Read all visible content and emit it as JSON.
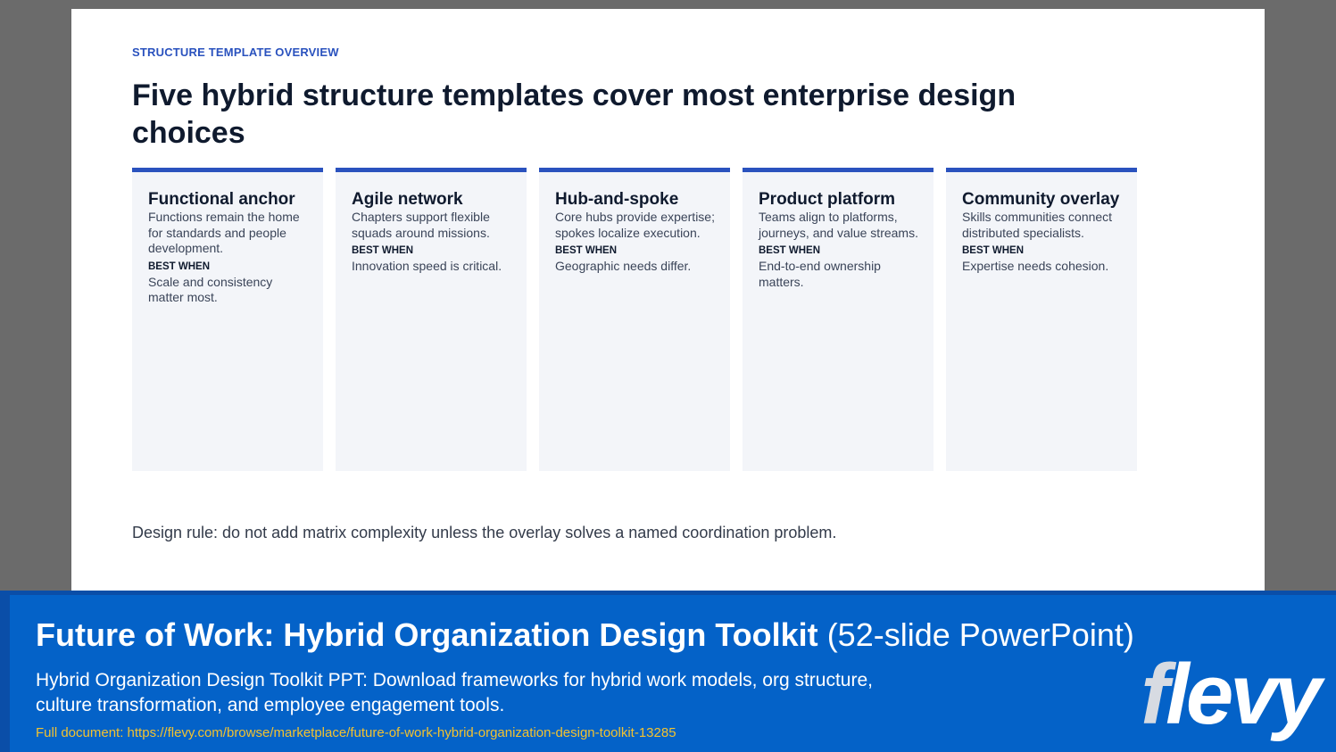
{
  "slide": {
    "eyebrow": "STRUCTURE TEMPLATE OVERVIEW",
    "title": "Five hybrid structure templates cover most enterprise design choices",
    "cards": [
      {
        "title": "Functional anchor",
        "desc": "Functions remain the home for standards and people development.",
        "label": "BEST WHEN",
        "best": "Scale and consistency matter most."
      },
      {
        "title": "Agile network",
        "desc": "Chapters support flexible squads around missions.",
        "label": "BEST WHEN",
        "best": "Innovation speed is critical."
      },
      {
        "title": "Hub-and-spoke",
        "desc": "Core hubs provide expertise; spokes localize execution.",
        "label": "BEST WHEN",
        "best": "Geographic needs differ."
      },
      {
        "title": "Product platform",
        "desc": "Teams align to platforms, journeys, and value streams.",
        "label": "BEST WHEN",
        "best": "End-to-end ownership matters."
      },
      {
        "title": "Community overlay",
        "desc": "Skills communities connect distributed specialists.",
        "label": "BEST WHEN",
        "best": "Expertise needs cohesion."
      }
    ],
    "rule": "Design rule: do not add matrix complexity unless the overlay solves a named coordination problem."
  },
  "footer": {
    "title_bold": "Future of Work: Hybrid Organization Design Toolkit",
    "title_suffix": " (52-slide PowerPoint)",
    "description": "Hybrid Organization Design Toolkit PPT: Download frameworks for hybrid work models, org structure, culture transformation, and employee engagement tools.",
    "link_prefix": "Full document: ",
    "link_url": "https://flevy.com/browse/marketplace/future-of-work-hybrid-organization-design-toolkit-13285",
    "logo_f": "f",
    "logo_rest": "levy"
  },
  "colors": {
    "accent": "#2a52be",
    "footer_bg": "#0462c8",
    "link": "#f2c230"
  }
}
